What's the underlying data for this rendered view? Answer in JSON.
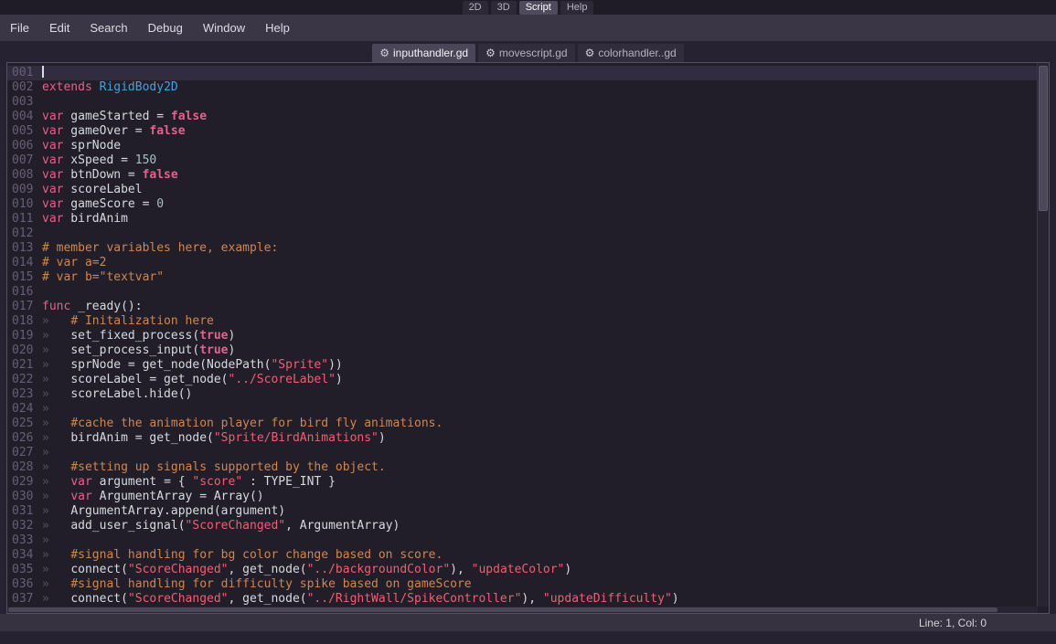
{
  "top_tabs": [
    {
      "label": "2D",
      "active": false
    },
    {
      "label": "3D",
      "active": false
    },
    {
      "label": "Script",
      "active": true
    },
    {
      "label": "Help",
      "active": false
    }
  ],
  "menu": [
    "File",
    "Edit",
    "Search",
    "Debug",
    "Window",
    "Help"
  ],
  "script_tabs": [
    {
      "label": "inputhandler.gd",
      "active": true
    },
    {
      "label": "movescript.gd",
      "active": false
    },
    {
      "label": "colorhandler..gd",
      "active": false
    }
  ],
  "editor": {
    "lines": [
      {
        "num": "001",
        "current": true,
        "cursor": true,
        "seg": []
      },
      {
        "num": "002",
        "seg": [
          {
            "t": "kw",
            "s": "extends"
          },
          {
            "t": "txt",
            "s": " "
          },
          {
            "t": "type",
            "s": "RigidBody2D"
          }
        ]
      },
      {
        "num": "003",
        "seg": []
      },
      {
        "num": "004",
        "seg": [
          {
            "t": "kw",
            "s": "var"
          },
          {
            "t": "txt",
            "s": " gameStarted = "
          },
          {
            "t": "kwb",
            "s": "false"
          }
        ]
      },
      {
        "num": "005",
        "seg": [
          {
            "t": "kw",
            "s": "var"
          },
          {
            "t": "txt",
            "s": " gameOver = "
          },
          {
            "t": "kwb",
            "s": "false"
          }
        ]
      },
      {
        "num": "006",
        "seg": [
          {
            "t": "kw",
            "s": "var"
          },
          {
            "t": "txt",
            "s": " sprNode"
          }
        ]
      },
      {
        "num": "007",
        "seg": [
          {
            "t": "kw",
            "s": "var"
          },
          {
            "t": "txt",
            "s": " xSpeed = "
          },
          {
            "t": "num",
            "s": "150"
          }
        ]
      },
      {
        "num": "008",
        "seg": [
          {
            "t": "kw",
            "s": "var"
          },
          {
            "t": "txt",
            "s": " btnDown = "
          },
          {
            "t": "kwb",
            "s": "false"
          }
        ]
      },
      {
        "num": "009",
        "seg": [
          {
            "t": "kw",
            "s": "var"
          },
          {
            "t": "txt",
            "s": " scoreLabel"
          }
        ]
      },
      {
        "num": "010",
        "seg": [
          {
            "t": "kw",
            "s": "var"
          },
          {
            "t": "txt",
            "s": " gameScore = "
          },
          {
            "t": "num",
            "s": "0"
          }
        ]
      },
      {
        "num": "011",
        "seg": [
          {
            "t": "kw",
            "s": "var"
          },
          {
            "t": "txt",
            "s": " birdAnim"
          }
        ]
      },
      {
        "num": "012",
        "seg": []
      },
      {
        "num": "013",
        "seg": [
          {
            "t": "com",
            "s": "# member variables here, example:"
          }
        ]
      },
      {
        "num": "014",
        "seg": [
          {
            "t": "com",
            "s": "# var a=2"
          }
        ]
      },
      {
        "num": "015",
        "seg": [
          {
            "t": "com",
            "s": "# var b=\"textvar\""
          }
        ]
      },
      {
        "num": "016",
        "seg": []
      },
      {
        "num": "017",
        "seg": [
          {
            "t": "kw",
            "s": "func"
          },
          {
            "t": "txt",
            "s": " _ready():"
          }
        ]
      },
      {
        "num": "018",
        "seg": [
          {
            "t": "ind",
            "s": "»   "
          },
          {
            "t": "com",
            "s": "# Initalization here"
          }
        ]
      },
      {
        "num": "019",
        "seg": [
          {
            "t": "ind",
            "s": "»   "
          },
          {
            "t": "txt",
            "s": "set_fixed_process("
          },
          {
            "t": "kwb",
            "s": "true"
          },
          {
            "t": "txt",
            "s": ")"
          }
        ]
      },
      {
        "num": "020",
        "seg": [
          {
            "t": "ind",
            "s": "»   "
          },
          {
            "t": "txt",
            "s": "set_process_input("
          },
          {
            "t": "kwb",
            "s": "true"
          },
          {
            "t": "txt",
            "s": ")"
          }
        ]
      },
      {
        "num": "021",
        "seg": [
          {
            "t": "ind",
            "s": "»   "
          },
          {
            "t": "txt",
            "s": "sprNode = get_node(NodePath("
          },
          {
            "t": "str",
            "s": "\"Sprite\""
          },
          {
            "t": "txt",
            "s": "))"
          }
        ]
      },
      {
        "num": "022",
        "seg": [
          {
            "t": "ind",
            "s": "»   "
          },
          {
            "t": "txt",
            "s": "scoreLabel = get_node("
          },
          {
            "t": "str",
            "s": "\"../ScoreLabel\""
          },
          {
            "t": "txt",
            "s": ")"
          }
        ]
      },
      {
        "num": "023",
        "seg": [
          {
            "t": "ind",
            "s": "»   "
          },
          {
            "t": "txt",
            "s": "scoreLabel.hide()"
          }
        ]
      },
      {
        "num": "024",
        "seg": [
          {
            "t": "ind",
            "s": "»"
          }
        ]
      },
      {
        "num": "025",
        "seg": [
          {
            "t": "ind",
            "s": "»   "
          },
          {
            "t": "com",
            "s": "#cache the animation player for bird fly animations."
          }
        ]
      },
      {
        "num": "026",
        "seg": [
          {
            "t": "ind",
            "s": "»   "
          },
          {
            "t": "txt",
            "s": "birdAnim = get_node("
          },
          {
            "t": "str",
            "s": "\"Sprite/BirdAnimations\""
          },
          {
            "t": "txt",
            "s": ")"
          }
        ]
      },
      {
        "num": "027",
        "seg": [
          {
            "t": "ind",
            "s": "»"
          }
        ]
      },
      {
        "num": "028",
        "seg": [
          {
            "t": "ind",
            "s": "»   "
          },
          {
            "t": "com",
            "s": "#setting up signals supported by the object."
          }
        ]
      },
      {
        "num": "029",
        "seg": [
          {
            "t": "ind",
            "s": "»   "
          },
          {
            "t": "kw",
            "s": "var"
          },
          {
            "t": "txt",
            "s": " argument = { "
          },
          {
            "t": "str",
            "s": "\"score\""
          },
          {
            "t": "txt",
            "s": " : TYPE_INT }"
          }
        ]
      },
      {
        "num": "030",
        "seg": [
          {
            "t": "ind",
            "s": "»   "
          },
          {
            "t": "kw",
            "s": "var"
          },
          {
            "t": "txt",
            "s": " ArgumentArray = Array()"
          }
        ]
      },
      {
        "num": "031",
        "seg": [
          {
            "t": "ind",
            "s": "»   "
          },
          {
            "t": "txt",
            "s": "ArgumentArray.append(argument)"
          }
        ]
      },
      {
        "num": "032",
        "seg": [
          {
            "t": "ind",
            "s": "»   "
          },
          {
            "t": "txt",
            "s": "add_user_signal("
          },
          {
            "t": "str",
            "s": "\"ScoreChanged\""
          },
          {
            "t": "txt",
            "s": ", ArgumentArray)"
          }
        ]
      },
      {
        "num": "033",
        "seg": [
          {
            "t": "ind",
            "s": "»"
          }
        ]
      },
      {
        "num": "034",
        "seg": [
          {
            "t": "ind",
            "s": "»   "
          },
          {
            "t": "com",
            "s": "#signal handling for bg color change based on score."
          }
        ]
      },
      {
        "num": "035",
        "seg": [
          {
            "t": "ind",
            "s": "»   "
          },
          {
            "t": "txt",
            "s": "connect("
          },
          {
            "t": "str",
            "s": "\"ScoreChanged\""
          },
          {
            "t": "txt",
            "s": ", get_node("
          },
          {
            "t": "str",
            "s": "\"../backgroundColor\""
          },
          {
            "t": "txt",
            "s": "), "
          },
          {
            "t": "str",
            "s": "\"updateColor\""
          },
          {
            "t": "txt",
            "s": ")"
          }
        ]
      },
      {
        "num": "036",
        "seg": [
          {
            "t": "ind",
            "s": "»   "
          },
          {
            "t": "com",
            "s": "#signal handling for difficulty spike based on gameScore"
          }
        ]
      },
      {
        "num": "037",
        "seg": [
          {
            "t": "ind",
            "s": "»   "
          },
          {
            "t": "txt",
            "s": "connect("
          },
          {
            "t": "str",
            "s": "\"ScoreChanged\""
          },
          {
            "t": "txt",
            "s": ", get_node("
          },
          {
            "t": "str",
            "s": "\"../RightWall/SpikeController\""
          },
          {
            "t": "txt",
            "s": "), "
          },
          {
            "t": "str",
            "s": "\"updateDifficulty\""
          },
          {
            "t": "txt",
            "s": ")"
          }
        ]
      }
    ]
  },
  "status": {
    "line_col": "Line: 1, Col: 0"
  },
  "colors": {
    "keyword": "#e5608f",
    "type": "#47a0dd",
    "string": "#ee5f70",
    "comment": "#d1854f",
    "text": "#d5dae0",
    "number": "#abbdca"
  }
}
